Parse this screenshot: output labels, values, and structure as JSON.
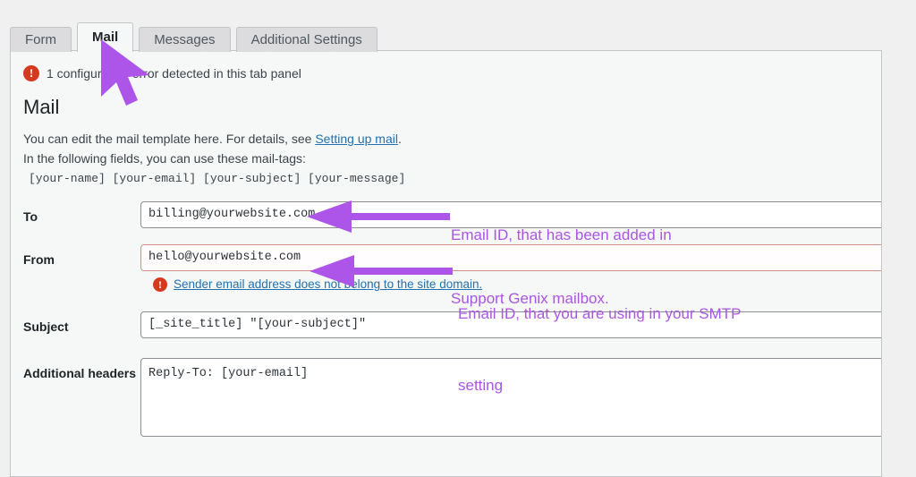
{
  "tabs": [
    {
      "label": "Form",
      "active": false
    },
    {
      "label": "Mail",
      "active": true
    },
    {
      "label": "Messages",
      "active": false
    },
    {
      "label": "Additional Settings",
      "active": false
    }
  ],
  "panel": {
    "notice": {
      "icon": "error-icon",
      "text": "1 configuration error detected in this tab panel"
    },
    "heading": "Mail",
    "description_before_link": "You can edit the mail template here. For details, see ",
    "description_link": "Setting up mail",
    "description_after_link": ".",
    "description_line2": "In the following fields, you can use these mail-tags:",
    "mail_tags": "[your-name] [your-email] [your-subject] [your-message]"
  },
  "fields": {
    "to": {
      "label": "To",
      "value": "billing@yourwebsite.com",
      "placeholder": "",
      "invalid": false
    },
    "from": {
      "label": "From",
      "value": "hello@yourwebsite.com",
      "placeholder": "",
      "invalid": true,
      "error_text": "Sender email address does not belong to the site domain.",
      "error_icon": "error-icon"
    },
    "subject": {
      "label": "Subject",
      "value": "[_site_title] \"[your-subject]\"",
      "placeholder": ""
    },
    "additional_headers": {
      "label": "Additional headers",
      "value": "Reply-To: [your-email]",
      "placeholder": ""
    }
  },
  "annotations": {
    "to_note_line1": "Email ID, that has been added in",
    "to_note_line2": "Support Genix mailbox.",
    "from_note_line1": "Email ID, that you are using in your SMTP",
    "from_note_line2": "setting"
  },
  "colors": {
    "annotation_purple": "#aa55e6",
    "error_red": "#d63a1e",
    "link_blue": "#2271b1",
    "invalid_border": "#d98b86",
    "panel_bg": "#f6f7f7",
    "page_bg": "#f0f0f1"
  }
}
